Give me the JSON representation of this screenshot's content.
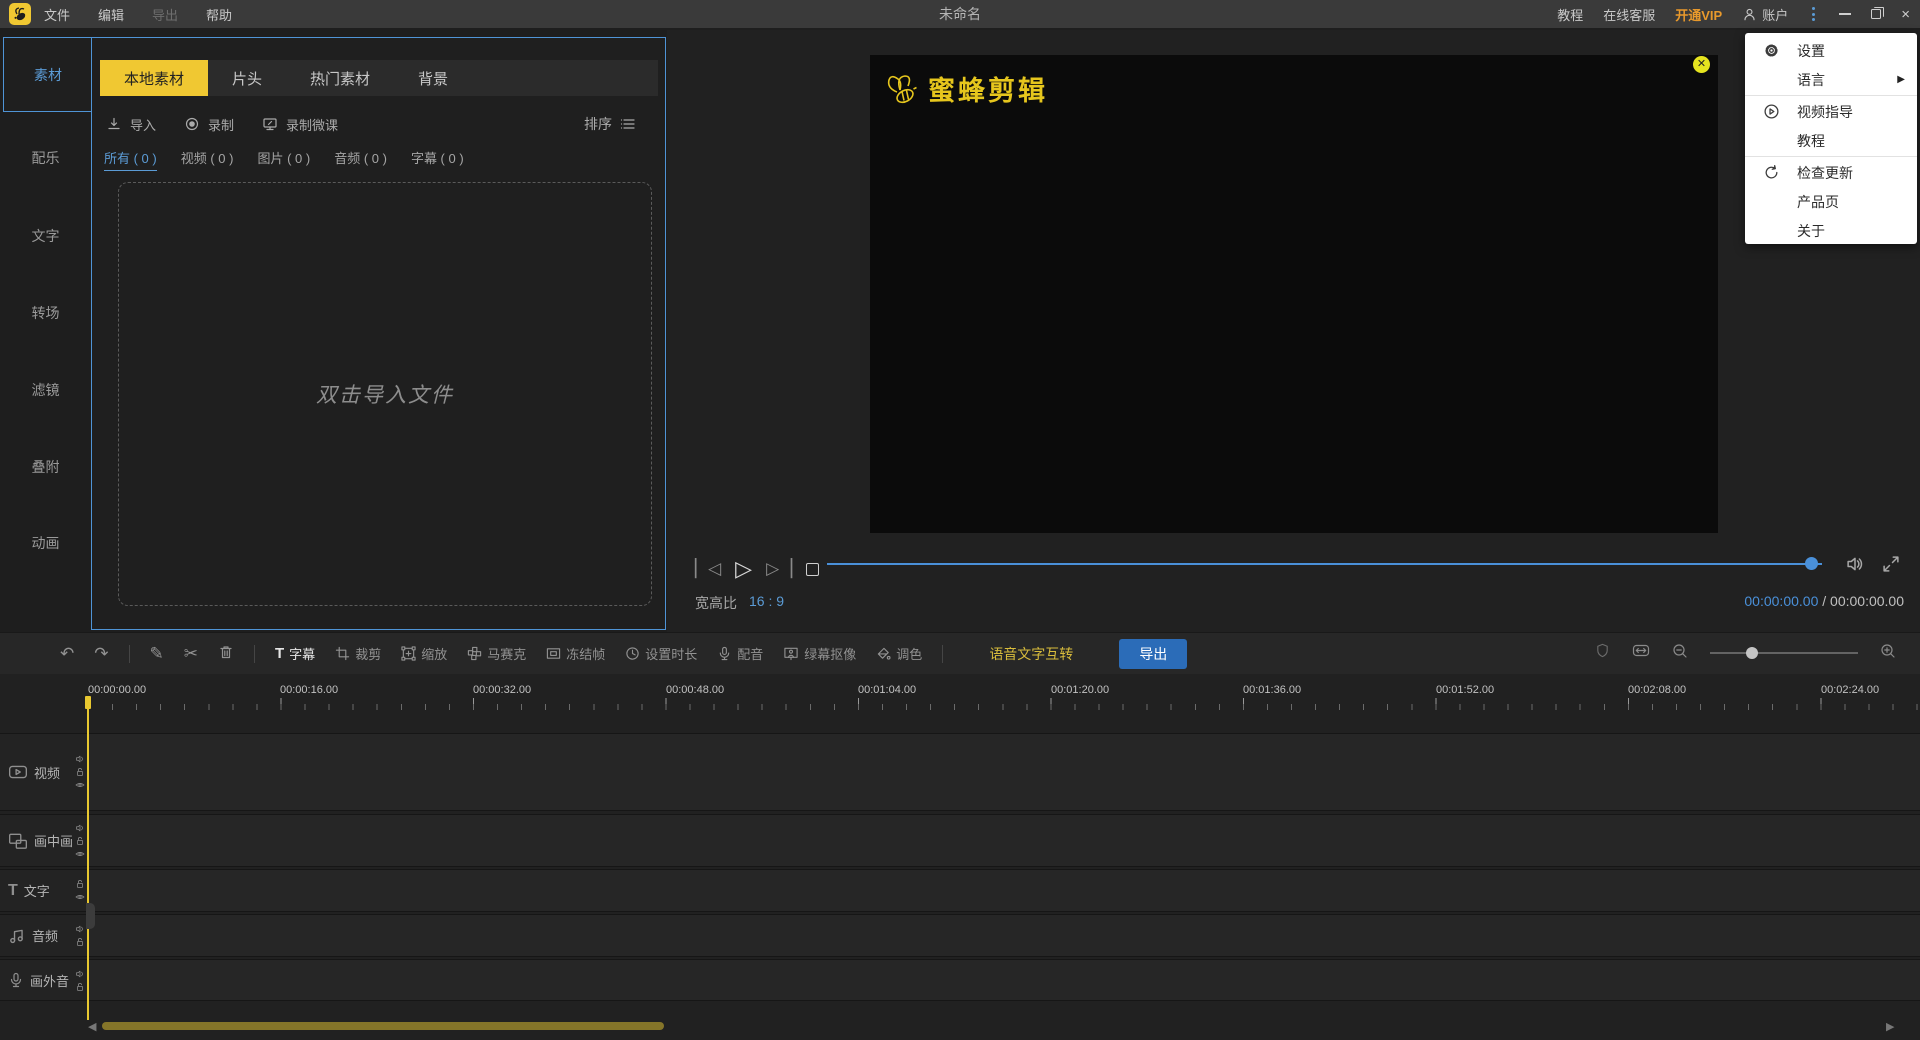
{
  "titlebar": {
    "menus": [
      {
        "label": "文件"
      },
      {
        "label": "编辑"
      },
      {
        "label": "导出",
        "disabled": true
      },
      {
        "label": "帮助"
      }
    ],
    "title": "未命名",
    "tutorial": "教程",
    "support": "在线客服",
    "vip": "开通VIP",
    "account": "账户",
    "window_icons": [
      "more-dots-icon",
      "minimize-icon",
      "maximize-icon",
      "close-icon"
    ]
  },
  "sidebar": {
    "items": [
      {
        "label": "素材",
        "active": true
      },
      {
        "label": "配乐"
      },
      {
        "label": "文字"
      },
      {
        "label": "转场"
      },
      {
        "label": "滤镜"
      },
      {
        "label": "叠附"
      },
      {
        "label": "动画"
      }
    ]
  },
  "materials": {
    "tabs": [
      {
        "label": "本地素材",
        "active": true
      },
      {
        "label": "片头"
      },
      {
        "label": "热门素材"
      },
      {
        "label": "背景"
      }
    ],
    "actions": {
      "import": "导入",
      "record": "录制",
      "record_lesson": "录制微课",
      "sort": "排序"
    },
    "filters": [
      {
        "label": "所有 ( 0 )",
        "active": true
      },
      {
        "label": "视频 ( 0 )"
      },
      {
        "label": "图片 ( 0 )"
      },
      {
        "label": "音频 ( 0 )"
      },
      {
        "label": "字幕 ( 0 )"
      }
    ],
    "dropzone_text": "双击导入文件"
  },
  "preview": {
    "watermark_text": "蜜蜂剪辑",
    "aspect_label": "宽高比",
    "aspect_value": "16 : 9",
    "time_current": "00:00:00.00",
    "time_separator": "/",
    "time_total": "00:00:00.00"
  },
  "toolbar": {
    "tools": [
      {
        "label": "字幕",
        "icon": "subtitle-icon",
        "highlighted": true
      },
      {
        "label": "裁剪",
        "icon": "crop-icon"
      },
      {
        "label": "缩放",
        "icon": "scale-icon"
      },
      {
        "label": "马赛克",
        "icon": "mosaic-icon"
      },
      {
        "label": "冻结帧",
        "icon": "freeze-frame-icon"
      },
      {
        "label": "设置时长",
        "icon": "clock-icon"
      },
      {
        "label": "配音",
        "icon": "mic-icon"
      },
      {
        "label": "绿幕抠像",
        "icon": "greenscreen-icon"
      },
      {
        "label": "调色",
        "icon": "color-icon"
      }
    ],
    "speech_text_label": "语音文字互转",
    "export_label": "导出"
  },
  "timeline": {
    "ruler_labels": [
      "00:00:00.00",
      "00:00:16.00",
      "00:00:32.00",
      "00:00:48.00",
      "00:01:04.00",
      "00:01:20.00",
      "00:01:36.00",
      "00:01:52.00",
      "00:02:08.00",
      "00:02:24.00"
    ],
    "tracks": [
      {
        "label": "视频",
        "icon": "video-track-icon",
        "side_icons": [
          "speaker",
          "lock",
          "eye"
        ]
      },
      {
        "label": "画中画",
        "icon": "pip-track-icon",
        "side_icons": [
          "speaker",
          "lock",
          "eye"
        ]
      },
      {
        "label": "文字",
        "icon": "text-track-icon",
        "side_icons": [
          "lock",
          "eye"
        ]
      },
      {
        "label": "音频",
        "icon": "audio-track-icon",
        "side_icons": [
          "speaker",
          "lock"
        ]
      },
      {
        "label": "画外音",
        "icon": "voice-track-icon",
        "side_icons": [
          "speaker",
          "lock"
        ]
      }
    ]
  },
  "context_menu": {
    "items": [
      {
        "label": "设置",
        "icon": "gear-icon"
      },
      {
        "label": "语言",
        "submenu": true
      },
      {
        "label": "视频指导",
        "icon": "play-circle-icon"
      },
      {
        "label": "教程"
      },
      {
        "label": "检查更新",
        "icon": "refresh-icon"
      },
      {
        "label": "产品页"
      },
      {
        "label": "关于"
      }
    ]
  },
  "colors": {
    "accent_blue": "#4a90d9",
    "accent_yellow": "#f0c832",
    "vip_orange": "#e8992c",
    "export_blue": "#2b6cb8",
    "watermark_yellow": "#e6c61d"
  }
}
